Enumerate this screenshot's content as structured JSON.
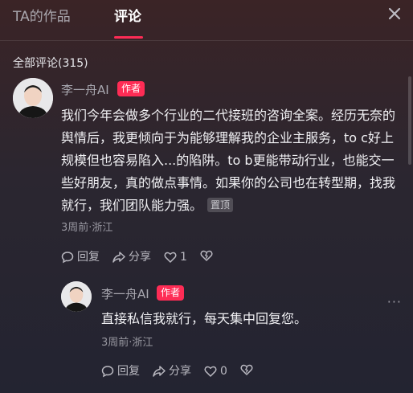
{
  "tabs": {
    "works": "TA的作品",
    "comments": "评论"
  },
  "comment_count_label": "全部评论(315)",
  "comments": [
    {
      "author": "李一舟AI",
      "badge": "作者",
      "text": "我们今年会做多个行业的二代接班的咨询全案。经历无奈的舆情后，我更倾向于为能够理解我的企业主服务，to c好上规模但也容易陷入...的陷阱。to b更能带动行业，也能交一些好朋友，真的做点事情。如果你的公司也在转型期，找我就行，我们团队能力强。",
      "pinned": "置顶",
      "time": "3周前·浙江",
      "reply": "回复",
      "share": "分享",
      "likes": "1"
    },
    {
      "author": "李一舟AI",
      "badge": "作者",
      "text": "直接私信我就行，每天集中回复您。",
      "time": "3周前·浙江",
      "reply": "回复",
      "share": "分享",
      "likes": "0"
    }
  ],
  "icons": [
    "close-icon",
    "reply-icon",
    "share-icon",
    "heart-icon",
    "dislike-icon",
    "more-icon"
  ]
}
